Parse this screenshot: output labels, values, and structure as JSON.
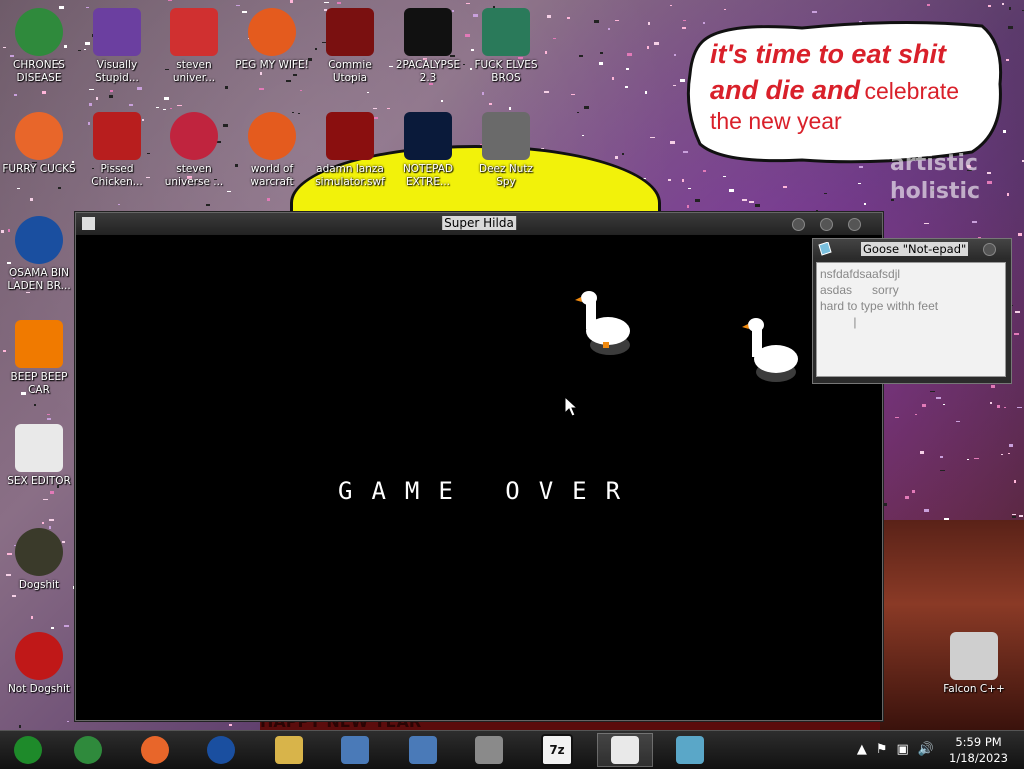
{
  "desktop_icons": [
    {
      "label": "CHRONES DISEASE",
      "icon": "chrome-icon",
      "color": "#2f8a3c"
    },
    {
      "label": "Visually Stupid...",
      "icon": "visual-studio-icon",
      "color": "#6b3fa0"
    },
    {
      "label": "steven univer...",
      "icon": "steven-universe-icon",
      "color": "#d03030"
    },
    {
      "label": "PEG MY WIFE!",
      "icon": "peggle-icon",
      "color": "#e45b1e"
    },
    {
      "label": "Commie Utopia",
      "icon": "commie-utopia-icon",
      "color": "#7a1010"
    },
    {
      "label": "2PACALYPSE 2.3",
      "icon": "terminal-icon",
      "color": "#111111"
    },
    {
      "label": "FUCK ELVES BROS",
      "icon": "elf-icon",
      "color": "#2a7a5a"
    },
    {
      "label": "FURRY CUCKS",
      "icon": "firefox-icon",
      "color": "#e8662a"
    },
    {
      "label": "Pissed Chicken...",
      "icon": "angry-birds-icon",
      "color": "#b81e1e"
    },
    {
      "label": "steven universe ...",
      "icon": "gem-icon",
      "color": "#c0243e"
    },
    {
      "label": "world of warcraft",
      "icon": "peggle-icon",
      "color": "#e45b1e"
    },
    {
      "label": "adamn lanza simulator.swf",
      "icon": "flash-icon",
      "color": "#8a0f0f"
    },
    {
      "label": "NOTEPAD EXTRE...",
      "icon": "notepad-extreme-icon",
      "color": "#0a1a3a"
    },
    {
      "label": "Deez Nutz Spy",
      "icon": "windows-stack-icon",
      "color": "#6a6a6a"
    },
    {
      "label": "OSAMA BIN LADEN BR...",
      "icon": "obama-logo-icon",
      "color": "#1a4fa0"
    },
    {
      "label": "BEEP BEEP CAR",
      "icon": "vlc-icon",
      "color": "#f07a00"
    },
    {
      "label": "SEX EDITOR",
      "icon": "hxd-icon",
      "color": "#e9e9e9"
    },
    {
      "label": "Dogshit",
      "icon": "codeblocks-icon",
      "color": "#3a3a2a"
    },
    {
      "label": "Not Dogshit",
      "icon": "devcpp-icon",
      "color": "#c01818"
    },
    {
      "label": "Falcon C++",
      "icon": "recycle-bin-icon",
      "color": "#cfcfcf"
    }
  ],
  "wallpaper": {
    "bubble_line1": "it's time to eat shit",
    "bubble_line2": "and die and",
    "bubble_line2b": "celebrate",
    "bubble_line3": "the new year",
    "bg_text1": "artistic",
    "bg_text2": "holistic",
    "bottom_banner": "HAPPY NEW YEAR"
  },
  "game_window": {
    "title": "Super Hilda",
    "game_over_text": "GAME OVER"
  },
  "notepad_window": {
    "title": "Goose \"Not-epad\"",
    "lines": [
      "nsfdafdsaafsdjl",
      "asdas      sorry",
      "hard to type withh feet",
      "          |"
    ]
  },
  "taskbar": {
    "items": [
      {
        "name": "start-button",
        "icon": "windows-orb-icon",
        "color": "#1e8a2a"
      },
      {
        "name": "taskbar-chrome",
        "icon": "chrome-icon",
        "color": "#2f8a3c"
      },
      {
        "name": "taskbar-firefox",
        "icon": "firefox-icon",
        "color": "#e8662a"
      },
      {
        "name": "taskbar-obama",
        "icon": "obama-logo-icon",
        "color": "#1a4fa0"
      },
      {
        "name": "taskbar-explorer",
        "icon": "folder-icon",
        "color": "#d8b44a"
      },
      {
        "name": "taskbar-network-1",
        "icon": "network-icon",
        "color": "#4a7ab8"
      },
      {
        "name": "taskbar-network-2",
        "icon": "network-icon",
        "color": "#4a7ab8"
      },
      {
        "name": "taskbar-archive",
        "icon": "archive-icon",
        "color": "#8a8a8a"
      },
      {
        "name": "taskbar-7zip",
        "icon": "7zip-icon",
        "color": "#f2f2f2",
        "text": "7z"
      },
      {
        "name": "taskbar-goose",
        "icon": "goose-icon",
        "color": "#e9e9e9"
      },
      {
        "name": "taskbar-notepad",
        "icon": "notepad-icon",
        "color": "#5aa7c8"
      }
    ],
    "tray_icons": [
      "chevron-up-icon",
      "flag-icon",
      "network-tray-icon",
      "volume-icon"
    ],
    "time": "5:59 PM",
    "date": "1/18/2023"
  }
}
